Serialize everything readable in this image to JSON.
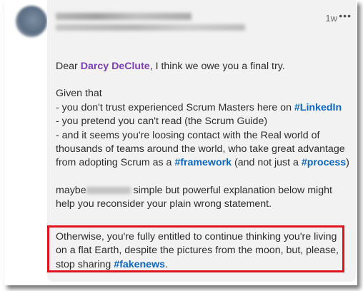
{
  "post": {
    "time": "1w",
    "more_icon": "•••"
  },
  "body": {
    "greeting_pre": "Dear ",
    "mention": "Darcy DeClute",
    "greeting_post": ", I think we owe you a final try.",
    "given_that": "Given that",
    "bullet1_pre": "- you don't trust experienced Scrum Masters here on ",
    "bullet1_tag": "#LinkedIn",
    "bullet2": "- you pretend you can't read (the Scrum Guide)",
    "bullet3_line1": "- and it seems you're loosing contact with the Real world of",
    "bullet3_line2": "thousands of teams around the world, who take great advantage",
    "bullet3_line3_pre": "from adopting Scrum as a ",
    "bullet3_tag1": "#framework",
    "bullet3_mid": " (and not just a ",
    "bullet3_tag2": "#process",
    "bullet3_post": ")",
    "maybe_pre": "maybe",
    "maybe_post": " simple but powerful explanation below might",
    "maybe_line2": "help you reconsider your plain wrong statement."
  },
  "highlight": {
    "line1": "Otherwise, you're fully entitled to continue thinking you're living",
    "line2": "on a flat Earth, despite the pictures from the moon, but, please,",
    "line3_pre": "stop sharing ",
    "line3_tag": "#fakenews",
    "line3_post": ".",
    "border_color": "#e0141e"
  },
  "colors": {
    "mention": "#7c3fb8",
    "hashtag": "#0a66c2",
    "card_bg": "#f2f2f2"
  }
}
